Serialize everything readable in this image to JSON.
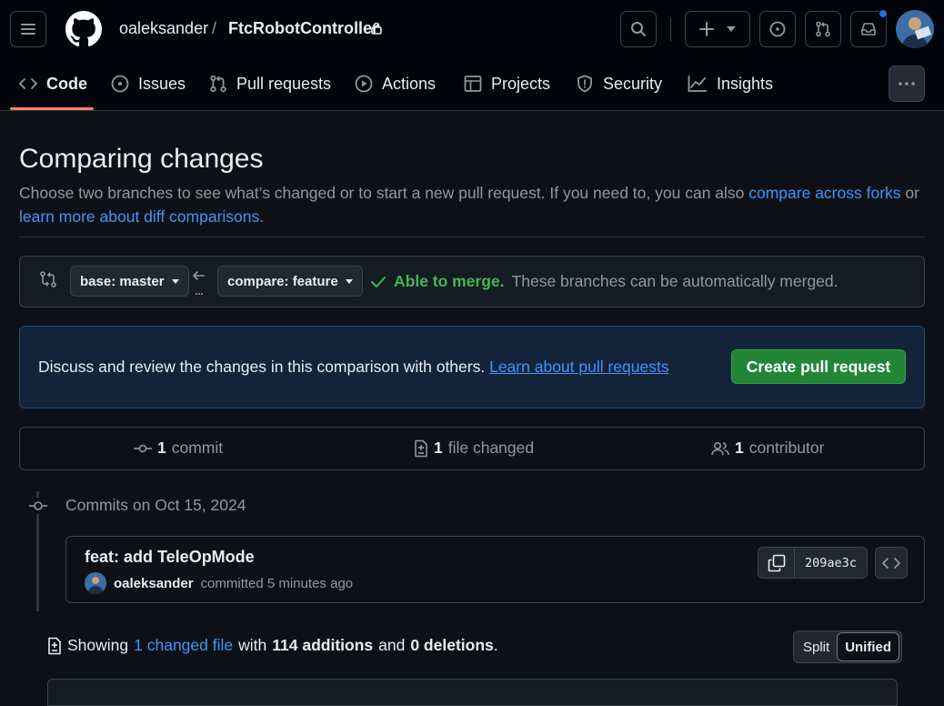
{
  "header": {
    "repo_owner": "oaleksander",
    "repo_separator": "/",
    "repo_name": "FtcRobotController",
    "icons": [
      "hamburger-icon",
      "github-logo-icon",
      "lock-icon",
      "search-icon",
      "plus-icon",
      "chevron-down-icon",
      "issue-circle-icon",
      "pull-request-icon",
      "inbox-icon"
    ],
    "notification_dot_color": "#1f6feb"
  },
  "tabs": [
    {
      "label": "Code",
      "icon": "code-icon",
      "active": true
    },
    {
      "label": "Issues",
      "icon": "issue-icon"
    },
    {
      "label": "Pull requests",
      "icon": "pull-request-icon"
    },
    {
      "label": "Actions",
      "icon": "play-icon"
    },
    {
      "label": "Projects",
      "icon": "table-icon"
    },
    {
      "label": "Security",
      "icon": "shield-icon"
    },
    {
      "label": "Insights",
      "icon": "graph-icon"
    }
  ],
  "page": {
    "title": "Comparing changes",
    "desc_prefix": "Choose two branches to see what’s changed or to start a new pull request. If you need to, you can also ",
    "desc_link1": "compare across forks",
    "desc_mid": " or ",
    "desc_link2": "learn more about diff comparisons",
    "desc_suffix": "."
  },
  "range": {
    "base_label": "base: master",
    "compare_label": "compare: feature",
    "merge_ok": "Able to merge.",
    "merge_text": "These branches can be automatically merged."
  },
  "discuss": {
    "text": "Discuss and review the changes in this comparison with others.",
    "link": "Learn about pull requests",
    "button": "Create pull request"
  },
  "summary": {
    "commits_count": "1",
    "commits_label": "commit",
    "files_count": "1",
    "files_label": "file changed",
    "contributors_count": "1",
    "contributors_label": "contributor"
  },
  "commits": {
    "date_heading": "Commits on Oct 15, 2024",
    "items": [
      {
        "title": "feat: add TeleOpMode",
        "author": "oaleksander",
        "action": "committed 5 minutes ago",
        "sha": "209ae3c"
      }
    ]
  },
  "diff": {
    "showing": "Showing",
    "changed_link": "1 changed file",
    "with": "with",
    "additions": "114 additions",
    "and": "and",
    "deletions": "0 deletions",
    "period": ".",
    "split_label": "Split",
    "unified_label": "Unified",
    "selected_mode": "Unified"
  },
  "colors": {
    "accent_blue": "#4493f8",
    "success_green": "#3fb950",
    "button_green": "#238636",
    "active_tab_underline": "#f78166",
    "background": "#0d1117"
  }
}
